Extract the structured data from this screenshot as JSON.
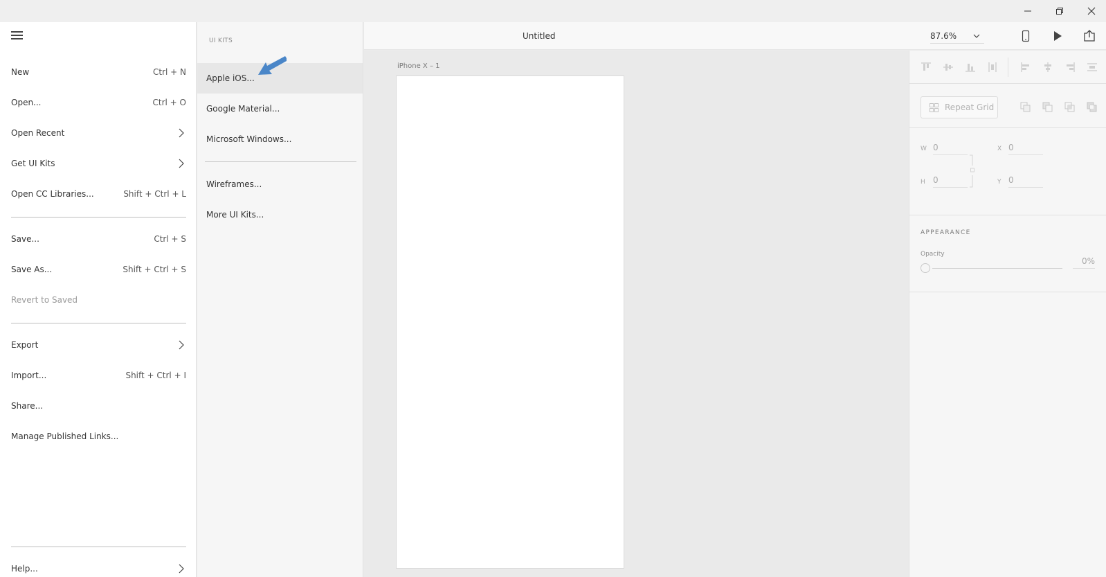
{
  "window": {
    "controls": [
      {
        "name": "minimize-button",
        "icon": "minimize-icon"
      },
      {
        "name": "restore-button",
        "icon": "restore-icon"
      },
      {
        "name": "close-button",
        "icon": "close-icon"
      }
    ]
  },
  "menu": {
    "items": [
      {
        "label": "New",
        "shortcut": "Ctrl + N"
      },
      {
        "label": "Open...",
        "shortcut": "Ctrl + O"
      },
      {
        "label": "Open Recent",
        "shortcut": ""
      },
      {
        "label": "Get UI Kits",
        "shortcut": ""
      },
      {
        "label": "Open CC Libraries...",
        "shortcut": "Shift + Ctrl + L"
      },
      {
        "label": "Save...",
        "shortcut": "Ctrl + S"
      },
      {
        "label": "Save As...",
        "shortcut": "Shift + Ctrl + S"
      },
      {
        "label": "Revert to Saved",
        "shortcut": ""
      },
      {
        "label": "Export",
        "shortcut": ""
      },
      {
        "label": "Import...",
        "shortcut": "Shift + Ctrl + I"
      },
      {
        "label": "Share...",
        "shortcut": ""
      },
      {
        "label": "Manage Published Links...",
        "shortcut": ""
      },
      {
        "label": "Help...",
        "shortcut": ""
      }
    ]
  },
  "submenu": {
    "header": "UI KITS",
    "items": [
      {
        "label": "Apple iOS..."
      },
      {
        "label": "Google Material..."
      },
      {
        "label": "Microsoft Windows..."
      },
      {
        "label": "Wireframes..."
      },
      {
        "label": "More UI Kits..."
      }
    ]
  },
  "header": {
    "title": "Untitled",
    "zoom": "87.6%",
    "icons": [
      "device-preview-icon",
      "play-icon",
      "share-icon"
    ]
  },
  "canvas": {
    "artboard_label": "iPhone X – 1"
  },
  "inspector": {
    "repeat_grid_label": "Repeat Grid",
    "w_label": "W",
    "w_value": "0",
    "h_label": "H",
    "h_value": "0",
    "x_label": "X",
    "x_value": "0",
    "y_label": "Y",
    "y_value": "0",
    "appearance_title": "APPEARANCE",
    "opacity_label": "Opacity",
    "opacity_value": "0%"
  },
  "colors": {
    "annotation_arrow": "#4a86c8",
    "hover_row": "#e7e7e7",
    "canvas": "#eaeaea"
  }
}
